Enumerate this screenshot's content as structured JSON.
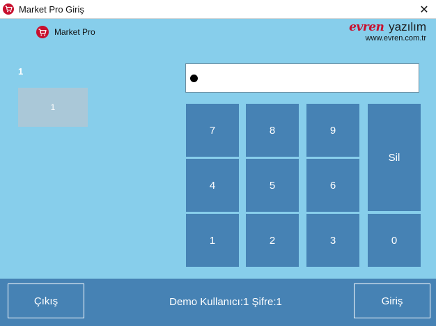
{
  "window": {
    "title": "Market Pro Giriş",
    "close_glyph": "✕"
  },
  "brand": {
    "name": "Market Pro",
    "icon": "cart-icon",
    "accent": "#c8102e"
  },
  "vendor": {
    "logo_word": "evren",
    "logo_suffix": "yazılım",
    "url": "www.evren.com.tr"
  },
  "users": {
    "group_label": "1",
    "tiles": [
      {
        "label": "1"
      }
    ]
  },
  "password": {
    "mask": "●",
    "dot_count": 1
  },
  "keypad": {
    "keys": {
      "k7": "7",
      "k8": "8",
      "k9": "9",
      "k4": "4",
      "k5": "5",
      "k6": "6",
      "k1": "1",
      "k2": "2",
      "k3": "3",
      "k0": "0"
    },
    "delete_label": "Sil"
  },
  "footer": {
    "exit_label": "Çıkış",
    "login_label": "Giriş",
    "demo_text": "Demo Kullanıcı:1 Şifre:1"
  },
  "colors": {
    "background": "#87CEEB",
    "button": "#4682B4",
    "tile": "#aac8d8"
  }
}
